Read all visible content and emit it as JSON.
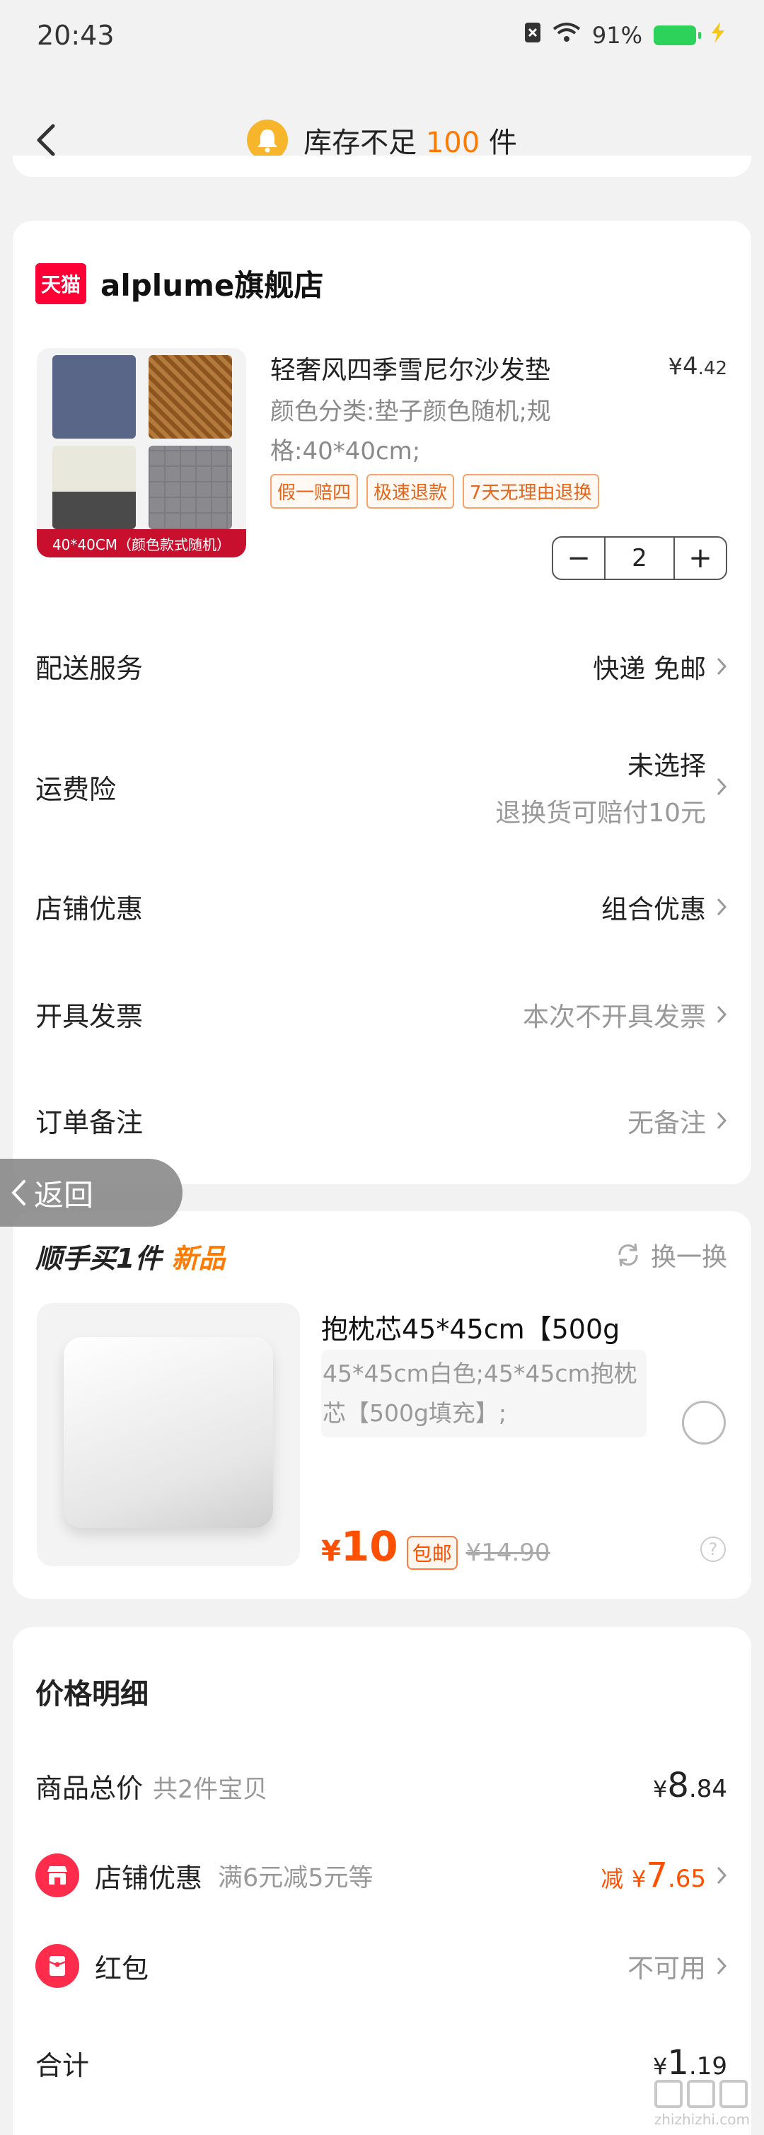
{
  "status": {
    "time": "20:43",
    "battery": "91%"
  },
  "nav": {
    "title_prefix": "库存不足",
    "title_number": "100",
    "title_suffix": "件"
  },
  "shop": {
    "logo_text": "天猫",
    "name": "alplume旗舰店"
  },
  "product": {
    "image_banner": "40*40CM（颜色款式随机）",
    "title": "轻奢风四季雪尼尔沙发垫",
    "price_yen": "¥",
    "price_int": "4",
    "price_dec": ".42",
    "spec": "颜色分类:垫子颜色随机;规格:40*40cm;",
    "tags": [
      "假一赔四",
      "极速退款",
      "7天无理由退换"
    ],
    "quantity": "2",
    "minus": "−",
    "plus": "+"
  },
  "rows": {
    "delivery": {
      "label": "配送服务",
      "value": "快递 免邮"
    },
    "insurance": {
      "label": "运费险",
      "value1": "未选择",
      "value2": "退换货可赔付10元"
    },
    "store_discount": {
      "label": "店铺优惠",
      "value": "组合优惠"
    },
    "invoice": {
      "label": "开具发票",
      "value": "本次不开具发票"
    },
    "note": {
      "label": "订单备注",
      "value": "无备注"
    }
  },
  "float_back": {
    "label": "返回"
  },
  "addon": {
    "title": "顺手买1件",
    "badge": "新品",
    "swap": "换一换",
    "name": "抱枕芯45*45cm【500g",
    "spec": "45*45cm白色;45*45cm抱枕芯【500g填充】;",
    "price_yen": "¥",
    "price": "10",
    "shipping": "包邮",
    "old_price": "¥14.90",
    "help": "?"
  },
  "price_detail": {
    "title": "价格明细",
    "total": {
      "label": "商品总价",
      "sub": "共2件宝贝",
      "yen": "¥",
      "int": "8",
      "dec": ".84"
    },
    "discount": {
      "label": "店铺优惠",
      "sub": "满6元减5元等",
      "prefix": "减",
      "yen": "¥",
      "int": "7",
      "dec": ".65"
    },
    "redpacket": {
      "label": "红包",
      "value": "不可用"
    },
    "sum": {
      "label": "合计",
      "yen": "¥",
      "int": "1",
      "dec": ".19"
    }
  },
  "watermark": {
    "text": "zhizhizhi.com"
  },
  "colors": {
    "accent": "#ff5000",
    "orange": "#ff7a00",
    "tmall": "#ff0036"
  }
}
